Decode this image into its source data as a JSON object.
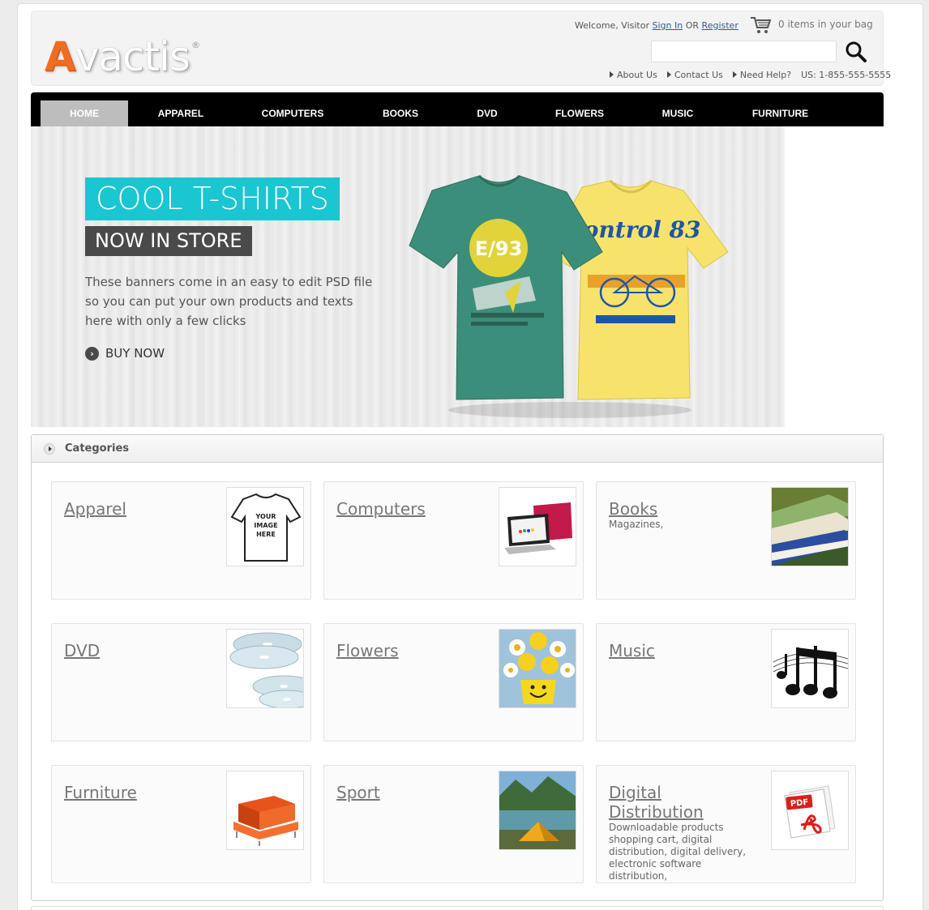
{
  "header": {
    "logo_first": "A",
    "logo_rest": "vactis",
    "logo_mark": "®",
    "welcome_prefix": "Welcome, Visitor",
    "sign_in": "Sign In",
    "or": "OR",
    "register": "Register",
    "cart_text": "0 items in your bag",
    "search_placeholder": "",
    "links": [
      "About Us",
      "Contact Us",
      "Need Help?"
    ],
    "phone": "US: 1-855-555-5555"
  },
  "nav": {
    "items": [
      "HOME",
      "APPAREL",
      "COMPUTERS",
      "BOOKS",
      "DVD",
      "FLOWERS",
      "MUSIC",
      "FURNITURE"
    ],
    "active": "HOME"
  },
  "banner": {
    "title": "COOL T-SHIRTS",
    "subtitle": "NOW IN STORE",
    "text": "These banners come in an easy to edit PSD file so you can put your own products and texts here with only a few clicks",
    "cta": "BUY NOW",
    "shirt1_text": "E/93",
    "shirt2_text": "Control 83"
  },
  "categories": {
    "heading": "Categories",
    "items": [
      {
        "name": "Apparel",
        "desc": "",
        "thumb_text": "YOUR IMAGE HERE"
      },
      {
        "name": "Computers",
        "desc": ""
      },
      {
        "name": "Books",
        "desc": "Magazines,"
      },
      {
        "name": "DVD",
        "desc": ""
      },
      {
        "name": "Flowers",
        "desc": ""
      },
      {
        "name": "Music",
        "desc": ""
      },
      {
        "name": "Furniture",
        "desc": ""
      },
      {
        "name": "Sport",
        "desc": ""
      },
      {
        "name": "Digital Distribution",
        "desc": "Downloadable products shopping cart, digital distribution, digital delivery, electronic software distribution,",
        "thumb_text": "PDF"
      }
    ]
  },
  "colors": {
    "accent_cyan": "#19c6d2",
    "logo_orange": "#ef6c21",
    "nav_bg": "#000000",
    "nav_active": "#bdbdbd"
  }
}
